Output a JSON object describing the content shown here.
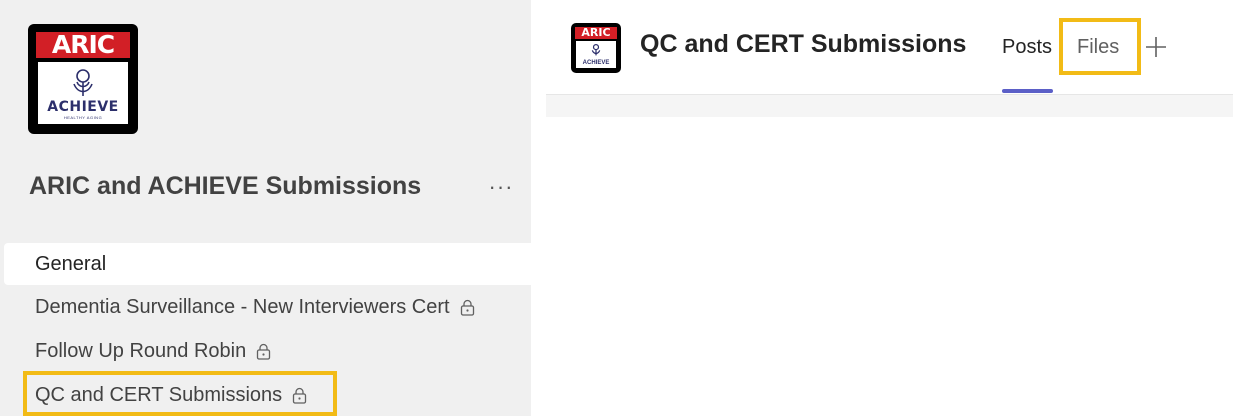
{
  "sidebar": {
    "logo": {
      "top_text": "ARIC",
      "brand_text": "ACHIEVE",
      "tagline": "HEALTHY AGING",
      "brand_red": "#d21f26",
      "brand_navy": "#2c2f6b"
    },
    "team_name": "ARIC and ACHIEVE Submissions",
    "more_icon": "ellipsis-icon",
    "more_label": "···",
    "channels": [
      {
        "label": "General",
        "private": false,
        "active": true
      },
      {
        "label": "Dementia Surveillance - New Interviewers Cert",
        "private": true,
        "active": false
      },
      {
        "label": "Follow Up Round Robin",
        "private": true,
        "active": false
      },
      {
        "label": "QC and CERT Submissions",
        "private": true,
        "active": false,
        "highlighted": true
      }
    ]
  },
  "header": {
    "avatar_top_text": "ARIC",
    "avatar_brand_text": "ACHIEVE",
    "channel_title": "QC and CERT Submissions",
    "tabs": [
      {
        "label": "Posts",
        "selected": true
      },
      {
        "label": "Files",
        "selected": false,
        "highlighted": true
      }
    ],
    "add_tab_icon": "plus-icon"
  },
  "colors": {
    "accent": "#5b5fc7",
    "highlight": "#f2bb16",
    "sidebar_bg": "#f0f0f0"
  }
}
